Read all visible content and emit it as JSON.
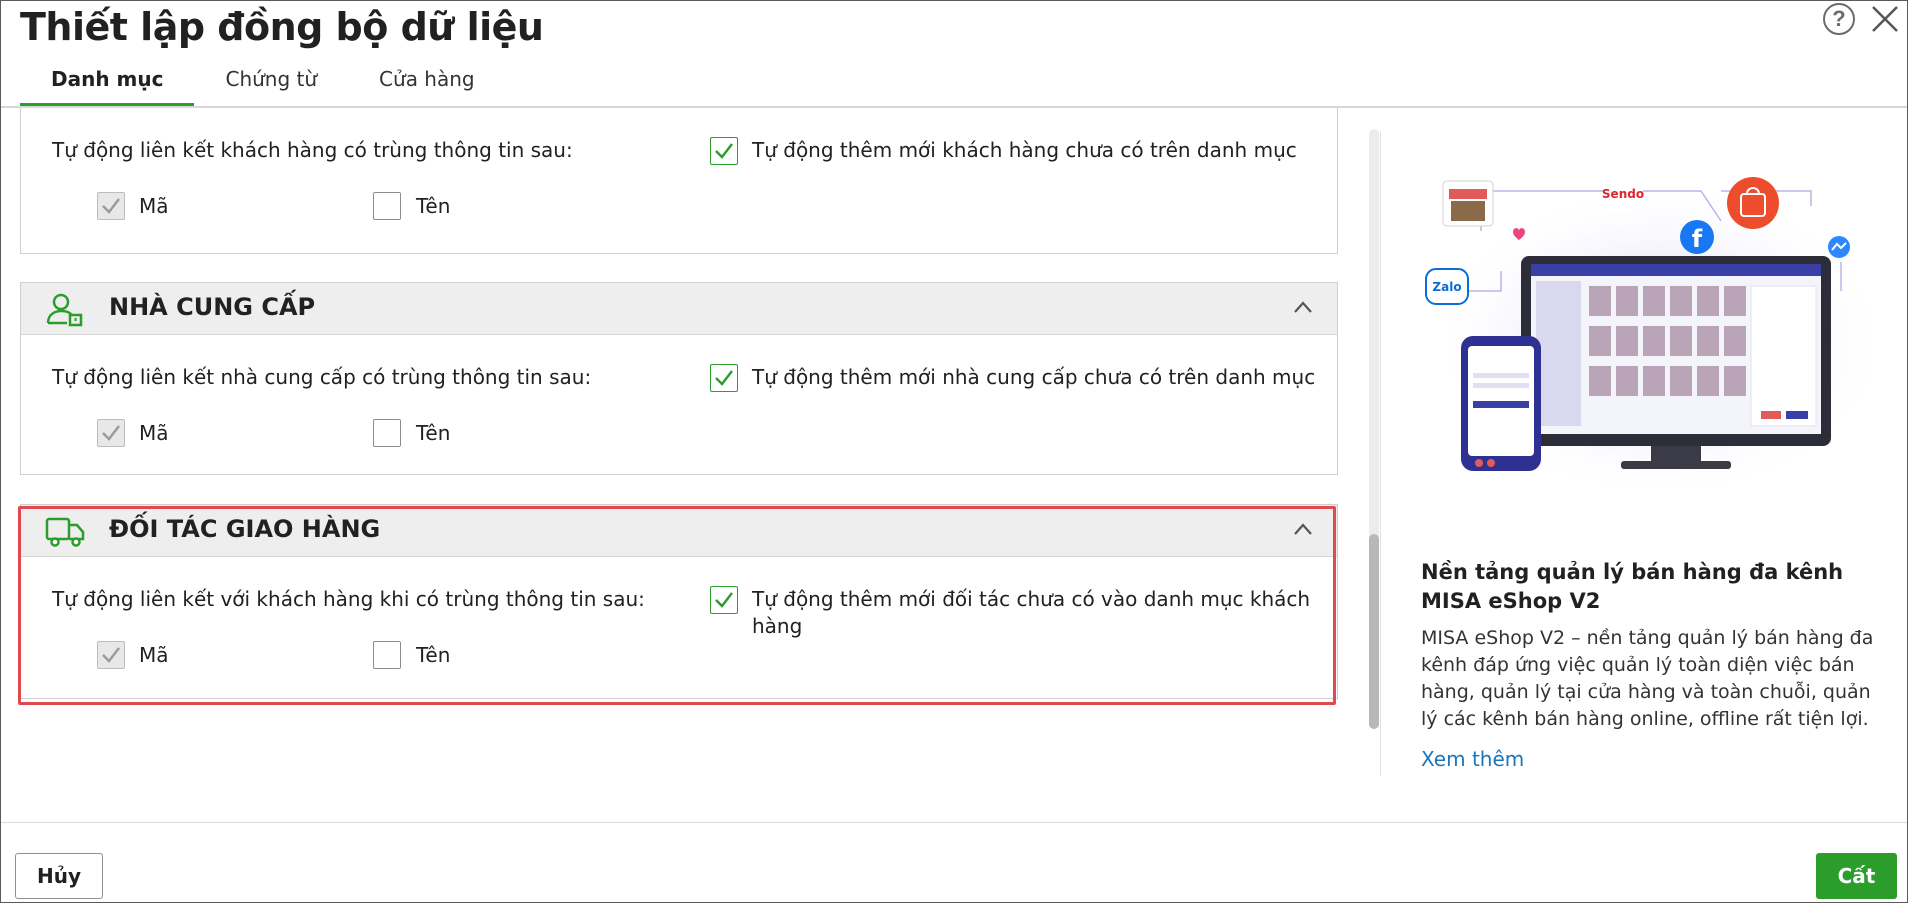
{
  "dialog": {
    "title": "Thiết lập đồng bộ dữ liệu",
    "help_icon": "?"
  },
  "tabs": [
    {
      "label": "Danh mục",
      "active": true
    },
    {
      "label": "Chứng từ",
      "active": false
    },
    {
      "label": "Cửa hàng",
      "active": false
    }
  ],
  "sections": {
    "customer": {
      "link_label": "Tự động liên kết khách hàng có trùng thông tin sau:",
      "auto_add_label": "Tự động thêm mới khách hàng chưa có trên danh mục",
      "auto_add_checked": true,
      "code_label": "Mã",
      "code_checked": true,
      "name_label": "Tên",
      "name_checked": false
    },
    "supplier": {
      "title": "NHÀ CUNG CẤP",
      "link_label": "Tự động liên kết nhà cung cấp có trùng thông tin sau:",
      "auto_add_label": "Tự động thêm mới nhà cung cấp chưa có trên danh mục",
      "auto_add_checked": true,
      "code_label": "Mã",
      "code_checked": true,
      "name_label": "Tên",
      "name_checked": false
    },
    "shipping": {
      "title": "ĐỐI TÁC GIAO HÀNG",
      "link_label": "Tự động liên kết với khách hàng khi có trùng thông tin sau:",
      "auto_add_label_1": "Tự động thêm mới đối tác chưa có vào danh mục khách",
      "auto_add_label_2": "hàng",
      "auto_add_checked": true,
      "code_label": "Mã",
      "code_checked": true,
      "name_label": "Tên",
      "name_checked": false
    }
  },
  "promo": {
    "title": "Nền tảng quản lý bán hàng đa kênh MISA eShop V2",
    "description": "MISA eShop V2 – nền tảng quản lý bán hàng đa kênh đáp ứng việc quản lý toàn diện việc bán hàng, quản lý tại cửa hàng và toàn chuỗi, quản lý các kênh bán hàng online, offline rất tiện lợi.",
    "link": "Xem thêm",
    "logo_zalo": "Zalo",
    "logo_sendo": "Sendo",
    "logo_facebook": "f"
  },
  "footer": {
    "cancel_label": "Hủy",
    "save_label": "Cất"
  },
  "colors": {
    "accent": "#2b9d2b",
    "highlight": "#e04a4f",
    "link": "#1b75bb"
  }
}
